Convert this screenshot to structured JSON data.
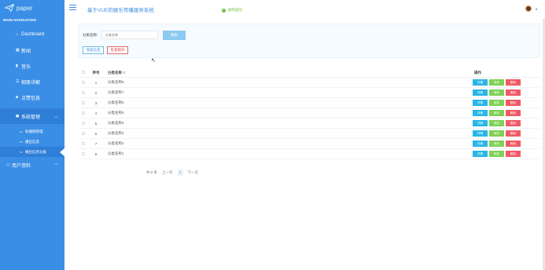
{
  "sidebar": {
    "logo_text": "paper",
    "heading": "MAIN NAVIGATION",
    "items": [
      {
        "icon": "⌂",
        "label": "Dashboard"
      },
      {
        "icon": "▦",
        "label": "新闻"
      },
      {
        "icon": "▮",
        "label": "音乐"
      },
      {
        "icon": "☰",
        "label": "相册详解"
      },
      {
        "icon": "■",
        "label": "点赞信息"
      },
      {
        "icon": "◼",
        "label": "系统管理"
      }
    ],
    "sub_items": [
      {
        "icon": "▭",
        "label": "轮播图管理"
      },
      {
        "icon": "▭",
        "label": "播出信息"
      },
      {
        "icon": "▭",
        "label": "播出信息分类"
      }
    ],
    "user_item": {
      "icon": "▭",
      "label": "用户资料"
    }
  },
  "header": {
    "title": "基于VUE的娱乐传播服务系统",
    "toast": "操作成功",
    "toast_icon": "✓"
  },
  "search": {
    "label": "分类名称:",
    "placeholder": "分类名称",
    "search_button": "搜索",
    "add_button": "添加信息",
    "batch_delete_button": "批量删除"
  },
  "table": {
    "headers": {
      "index": "序号",
      "name": "分类名称",
      "ops": "操作"
    },
    "rows": [
      {
        "index": "1",
        "name": "分类名称8"
      },
      {
        "index": "2",
        "name": "分类名称7"
      },
      {
        "index": "3",
        "name": "分类名称6"
      },
      {
        "index": "4",
        "name": "分类名称5"
      },
      {
        "index": "5",
        "name": "分类名称4"
      },
      {
        "index": "6",
        "name": "分类名称3"
      },
      {
        "index": "7",
        "name": "分类名称2"
      },
      {
        "index": "8",
        "name": "分类名称1"
      }
    ],
    "op_labels": {
      "view": "详情",
      "edit": "修改",
      "del": "删除"
    }
  },
  "pager": {
    "total": "共 8 条",
    "prev": "上一页",
    "current": "1",
    "next": "下一页"
  },
  "colors": {
    "sidebar": "#3a8ee6",
    "view": "#29b6e6",
    "edit": "#7fd157",
    "delete": "#f05a66"
  }
}
